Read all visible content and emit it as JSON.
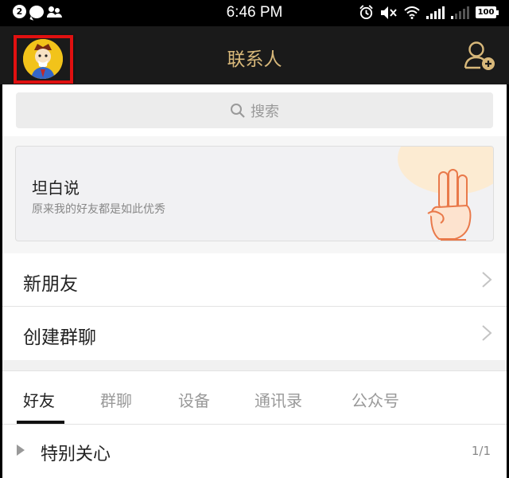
{
  "status_bar": {
    "notification_count": "2",
    "time": "6:46 PM",
    "battery": "100",
    "icons": [
      "notification-badge-icon",
      "chat-bubble-icon",
      "people-icon",
      "alarm-icon",
      "mute-icon",
      "wifi-icon",
      "signal-icon",
      "signal-weak-icon",
      "battery-icon"
    ]
  },
  "header": {
    "title": "联系人",
    "title_color": "#d8b87a",
    "background": "#1a1a1a",
    "highlight_color": "#e01010",
    "icons": [
      "avatar",
      "add-contact-icon"
    ]
  },
  "search": {
    "placeholder": "搜索",
    "icon": "search-icon"
  },
  "promo": {
    "title": "坦白说",
    "subtitle": "原来我的好友都是如此优秀",
    "icon": "hand-gesture-icon"
  },
  "menu": {
    "new_friends": "新朋友",
    "create_group": "创建群聊",
    "icon": "chevron-right-icon"
  },
  "tabs": [
    {
      "label": "好友",
      "active": true
    },
    {
      "label": "群聊",
      "active": false
    },
    {
      "label": "设备",
      "active": false
    },
    {
      "label": "通讯录",
      "active": false
    },
    {
      "label": "公众号",
      "active": false
    }
  ],
  "groups": [
    {
      "name": "特别关心",
      "count": "1/1",
      "icon": "expand-triangle-icon"
    }
  ]
}
